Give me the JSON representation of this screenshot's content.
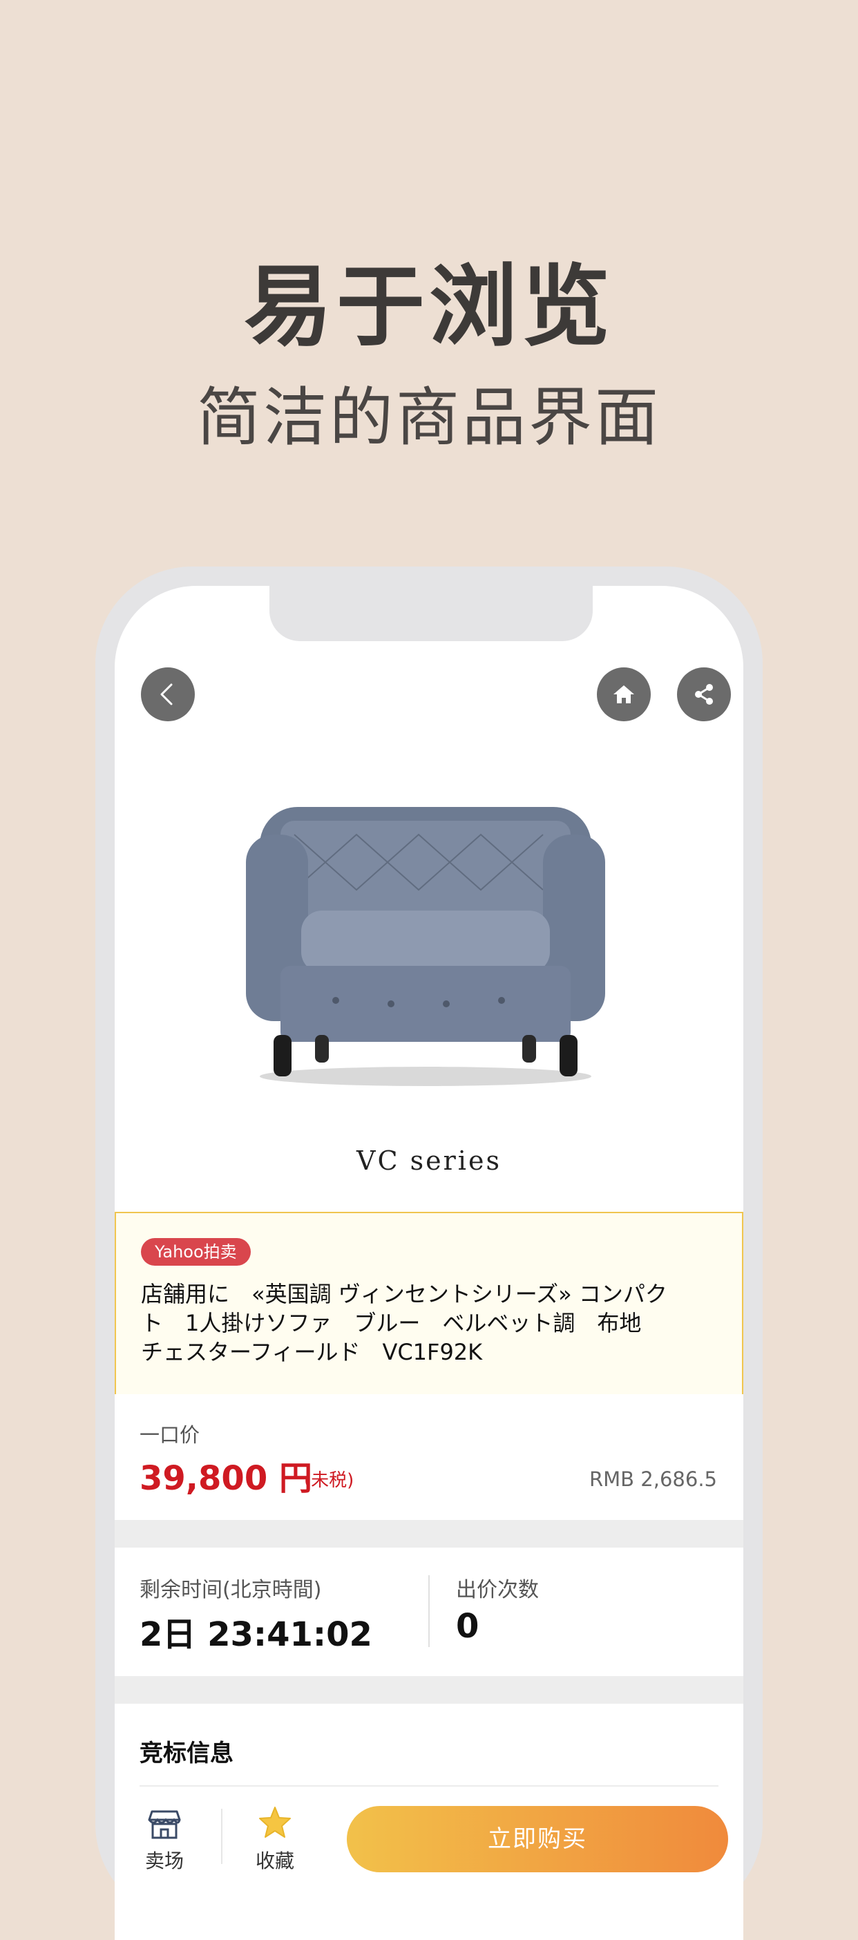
{
  "hero": {
    "title": "易于浏览",
    "subtitle": "简洁的商品界面"
  },
  "product": {
    "series_label": "VC series",
    "badge": "Yahoo拍卖",
    "title": "店舗用に　«英国調 ヴィンセントシリーズ» コンパク\nト　1人掛けソファ　ブルー　ベルベット調　布地\nチェスターフィールド　VC1F92K"
  },
  "price": {
    "label": "一口价",
    "value": "39,800 円",
    "tax_note": "(未税)",
    "rmb": "RMB 2,686.5"
  },
  "auction": {
    "time_label": "剩余时间(北京時間)",
    "time_value": "2日  23:41:02",
    "bids_label": "出价次数",
    "bids_value": "0"
  },
  "bid_info": {
    "title": "竞标信息"
  },
  "bottom_bar": {
    "store_label": "卖场",
    "favorite_label": "收藏",
    "buy_label": "立即购买"
  },
  "colors": {
    "background": "#eddfd3",
    "price_red": "#cf1a22",
    "badge_red": "#d9464d",
    "button_gradient_start": "#f2c14a",
    "button_gradient_end": "#f08a3c"
  },
  "icons": {
    "back": "chevron-left-icon",
    "home": "home-icon",
    "share": "share-icon",
    "store": "store-icon",
    "favorite": "star-icon"
  }
}
